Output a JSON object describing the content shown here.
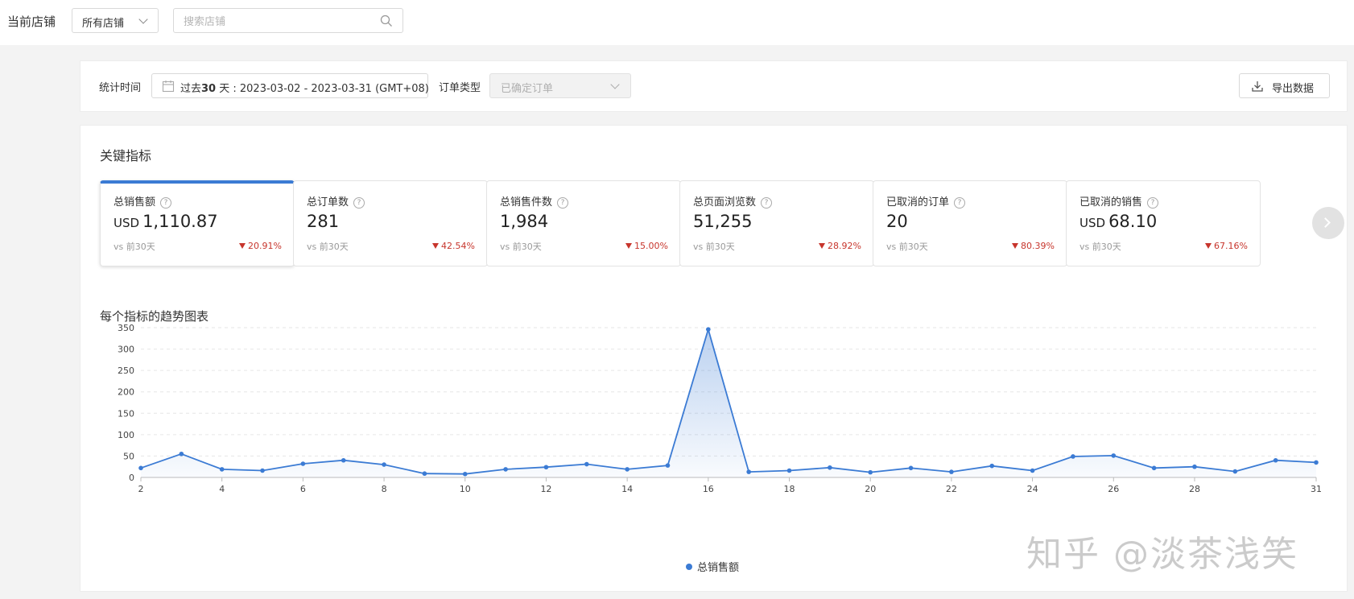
{
  "topbar": {
    "store_label": "当前店铺",
    "store_select_value": "所有店铺",
    "search_placeholder": "搜索店铺"
  },
  "filters": {
    "time_label": "统计时间",
    "date_prefix": "过去",
    "date_days": "30",
    "date_suffix": " 天 : 2023-03-02 - 2023-03-31 (GMT+08)",
    "order_type_label": "订单类型",
    "order_type_value": "已确定订单",
    "export_label": "导出数据"
  },
  "metrics_section": {
    "title": "关键指标",
    "compare_text": "vs 前30天",
    "cards": [
      {
        "name": "总销售额",
        "currency": "USD",
        "value": "1,110.87",
        "change": "20.91%",
        "active": true
      },
      {
        "name": "总订单数",
        "currency": "",
        "value": "281",
        "change": "42.54%",
        "active": false
      },
      {
        "name": "总销售件数",
        "currency": "",
        "value": "1,984",
        "change": "15.00%",
        "active": false
      },
      {
        "name": "总页面浏览数",
        "currency": "",
        "value": "51,255",
        "change": "28.92%",
        "active": false
      },
      {
        "name": "已取消的订单",
        "currency": "",
        "value": "20",
        "change": "80.39%",
        "active": false
      },
      {
        "name": "已取消的销售",
        "currency": "USD",
        "value": "68.10",
        "change": "67.16%",
        "active": false
      }
    ]
  },
  "trend_section": {
    "title": "每个指标的趋势图表"
  },
  "chart_data": {
    "type": "area",
    "x": [
      2,
      3,
      4,
      5,
      6,
      7,
      8,
      9,
      10,
      11,
      12,
      13,
      14,
      15,
      16,
      17,
      18,
      19,
      20,
      21,
      22,
      23,
      24,
      25,
      26,
      27,
      28,
      29,
      30,
      31
    ],
    "series": [
      {
        "name": "总销售额",
        "values": [
          22,
          55,
          19,
          16,
          32,
          40,
          30,
          9,
          8,
          19,
          24,
          31,
          19,
          28,
          346,
          13,
          16,
          23,
          12,
          22,
          13,
          27,
          16,
          49,
          51,
          22,
          25,
          14,
          40,
          35
        ]
      }
    ],
    "y_ticks": [
      0,
      50,
      100,
      150,
      200,
      250,
      300,
      350
    ],
    "x_ticks": [
      2,
      4,
      6,
      8,
      10,
      12,
      14,
      16,
      18,
      20,
      22,
      24,
      26,
      28,
      31
    ],
    "ylim": [
      0,
      350
    ],
    "grid": true,
    "legend": "bottom-center",
    "color": "#3b7bd4"
  },
  "watermark": "知乎 @淡茶浅笑"
}
